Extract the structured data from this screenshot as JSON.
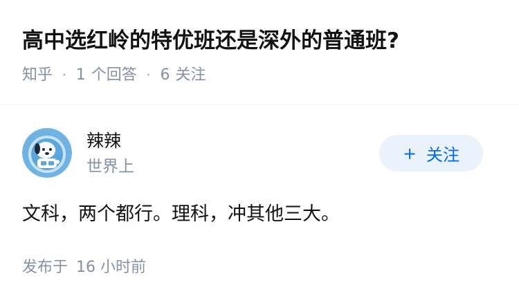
{
  "question": {
    "title": "高中选红岭的特优班还是深外的普通班?",
    "meta": {
      "source": "知乎",
      "separator": "·",
      "answer_count": "1",
      "answer_label": "个回答",
      "follower_count": "6",
      "follower_label": "关注"
    }
  },
  "answer": {
    "author": {
      "name": "辣辣",
      "headline": "世界上",
      "avatar_icon": "cartoon-dog-astronaut-icon"
    },
    "follow_button": {
      "icon": "plus-icon",
      "plus": "+",
      "label": "关注"
    },
    "content": "文科，两个都行。理科，冲其他三大。",
    "time": {
      "prefix": "发布于",
      "value": "16 小时前"
    }
  },
  "colors": {
    "primary_text": "#121212",
    "secondary_text": "#8590a6",
    "accent": "#0066ff",
    "follow_bg": "#eaf2fb",
    "divider": "#f0f2f7",
    "avatar_bg": "#6fb3e4"
  }
}
